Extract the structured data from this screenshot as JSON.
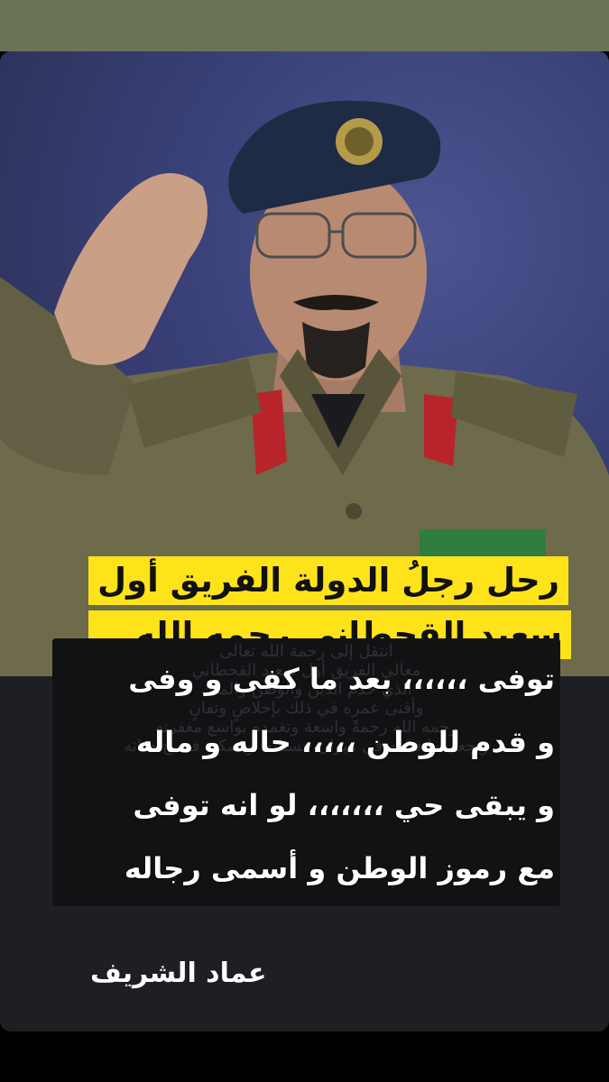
{
  "headline": {
    "line1": "رحل رجلُ الدولة الفريق أول",
    "line2": "سعيد القحطاني رحمه الله..."
  },
  "background_text": [
    "انتقل إلى رحمة الله تعالى",
    "معالي الفريق أول سعيد القحطاني",
    "الذي خدم الدين والوطن والملك",
    "وأفنى عمره في ذلك بإخلاصٍ وتفانٍ",
    "رحمه الله رحمةً واسعة وتغمده بواسع مغفرته",
    "ويجعل ما قدّمه في ميزان حسناته، ويسكنه فسيح جناته"
  ],
  "poem": [
    "توفى ،،،،،، بعد ما كفى و وفى",
    "و قدم للوطن ،،،،، حاله و ماله",
    "و يبقى حي ،،،،،،، لو انه توفى",
    "مع رموز الوطن و أسمى رجاله"
  ],
  "signature": "عماد الشريف",
  "colors": {
    "headline_bg": "#ffe31a",
    "top_bar": "#6b7355",
    "card_bg": "#1c1d21",
    "uniform": "#6e6a4c",
    "beret": "#1f2a44"
  }
}
